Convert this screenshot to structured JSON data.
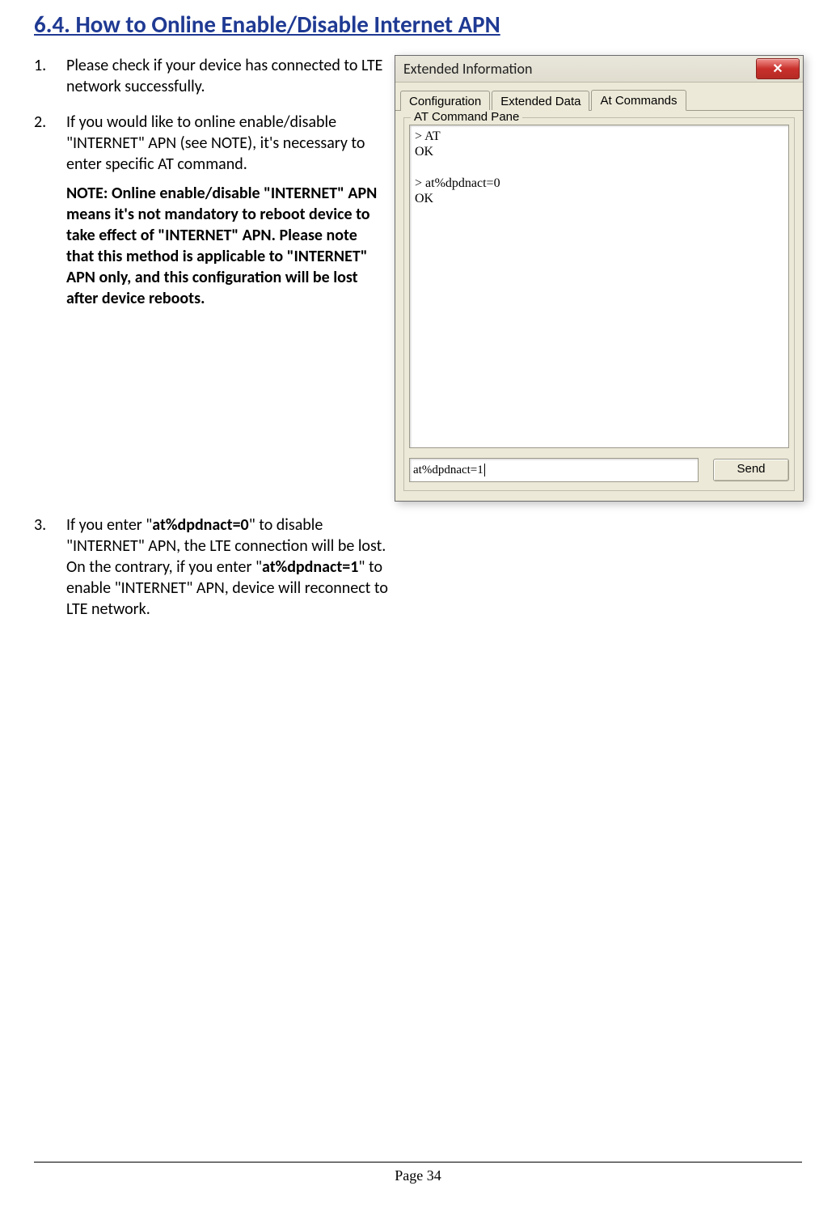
{
  "heading": "6.4. How to Online Enable/Disable Internet APN",
  "steps": {
    "item1_num": "1.",
    "item1_text": "Please check if your device has connected to LTE network successfully.",
    "item2_num": "2.",
    "item2_text": "If you would like to online enable/disable \"INTERNET\" APN (see NOTE), it's necessary to enter specific AT command.",
    "item2_note": "NOTE: Online enable/disable \"INTERNET\" APN means it's not mandatory to reboot device to take effect of \"INTERNET\" APN. Please note that this method is applicable to \"INTERNET\" APN only, and this configuration will be lost after device reboots.",
    "item3_num": "3.",
    "item3_pre": "If you enter \"",
    "item3_cmd0": "at%dpdnact=0",
    "item3_mid": "\" to disable \"INTERNET\" APN, the LTE connection will be lost. On the contrary, if you enter \"",
    "item3_cmd1": "at%dpdnact=1",
    "item3_post": "\" to enable \"INTERNET\" APN, device will reconnect to LTE network."
  },
  "dialog": {
    "title": "Extended Information",
    "close_glyph": "✕",
    "tabs": {
      "t1": "Configuration",
      "t2": "Extended Data",
      "t3": "At Commands"
    },
    "group_label": "AT Command Pane",
    "console_text": "> AT\nOK\n\n> at%dpdnact=0\nOK",
    "input_value": "at%dpdnact=1",
    "send_label": "Send"
  },
  "footer": "Page 34"
}
